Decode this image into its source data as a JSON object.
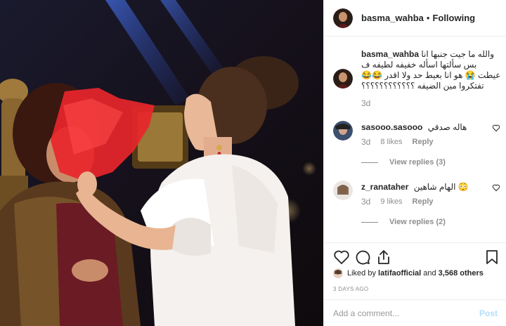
{
  "post": {
    "username": "basma_wahba",
    "follow_status": "Following",
    "separator": "•",
    "caption_username": "basma_wahba",
    "caption_text": "والله ما جيت جنبها انا بس سألتها اسأله خفيفه لطيفه ف عيطت 😭 هو انا بعيط حد ولا اقدر 😂😂 تفتكروا مين الضيفه ؟؟؟؟؟؟؟؟؟؟؟؟",
    "caption_time": "3d"
  },
  "comments": [
    {
      "username": "sasooo.sasooo",
      "text": "هاله صدقي",
      "time": "3d",
      "likes": "8 likes",
      "reply": "Reply",
      "view_replies": "View replies (3)"
    },
    {
      "username": "z_ranataher",
      "text": "الهام شاهين 😳",
      "time": "3d",
      "likes": "9 likes",
      "reply": "Reply",
      "view_replies": "View replies (2)"
    }
  ],
  "liked_by": {
    "prefix": "Liked by",
    "user": "latifaofficial",
    "connector": "and",
    "others": "3,568 others"
  },
  "date": "3 DAYS AGO",
  "add_comment": {
    "placeholder": "Add a comment...",
    "post_label": "Post"
  },
  "icons": [
    "heart-icon",
    "comment-icon",
    "share-icon",
    "bookmark-icon"
  ],
  "colors": {
    "link_disabled": "#b2dffc",
    "muted": "#8e8e8e",
    "border": "#efefef",
    "fan_red": "#e8262b"
  }
}
